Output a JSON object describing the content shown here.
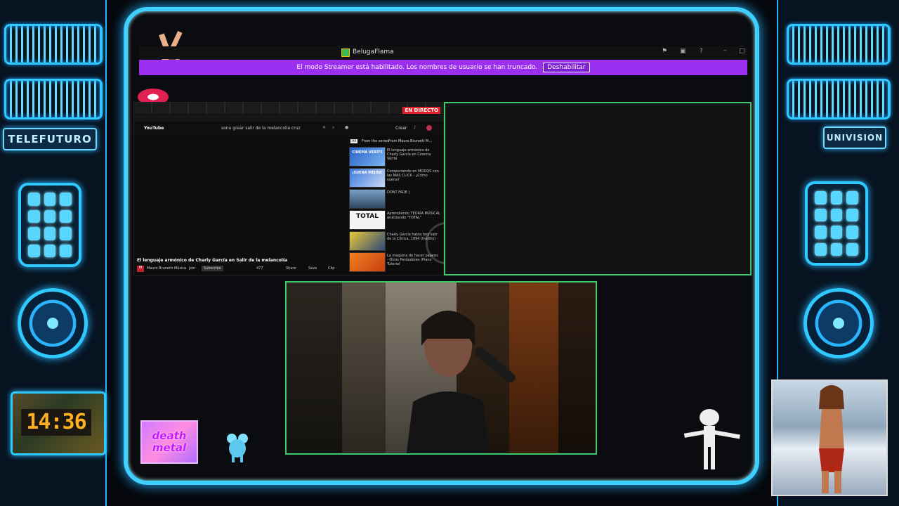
{
  "left_panel": {
    "sign": "TELEFUTURO",
    "clock": "14:36"
  },
  "right_panel": {
    "sign": "UNIVISION"
  },
  "window": {
    "title": "BelugaFlama"
  },
  "streamer_banner": {
    "message": "El modo Streamer está habilitado. Los nombres de usuario se han truncado.",
    "button": "Deshabilitar"
  },
  "browser": {
    "live_badge": "EN DIRECTO",
    "logo": "YouTube",
    "search_query": "sonu grear salir de la melancolia cruz",
    "create_label": "Crear",
    "chips": [
      "All",
      "From the series",
      "From Mauro Brunetti M..."
    ],
    "video_title": "El lenguaje armónico de Charly García en Salir de la melancolía",
    "channel_name": "Mauro Brunetti Música",
    "join_label": "Join",
    "subscribe_label": "Subscribe",
    "like_count": "477",
    "share_label": "Share",
    "save_label": "Save",
    "clip_label": "Clip",
    "thumb_labels": [
      "CINEMA VERITE",
      "¡SUENA MEJOR!",
      "",
      "TOTAL",
      "",
      ""
    ],
    "related_videos": [
      {
        "title": "El lenguaje armónico de Charly García en Cinema Verité"
      },
      {
        "title": "Componiendo en MODOS con las MAS CLICK - ¿Cómo suena?"
      },
      {
        "title": "DONT FADE |"
      },
      {
        "title": "Aprendiendo TEORIA MUSICAL analizando \"TOTAL\""
      },
      {
        "title": "Charly García habla hoy salir de la Clínica, 1994 (Inédito)"
      },
      {
        "title": "La maquina de hacer pájaros - Otros Perdedores (Piano Tutorial"
      }
    ]
  },
  "overlay": {
    "sticker_text": "death metal"
  },
  "colors": {
    "frame_accent": "#3fd0ff",
    "banner": "#9b2ff0",
    "live_badge": "#e0202a",
    "cam_border": "#3fc86a"
  }
}
